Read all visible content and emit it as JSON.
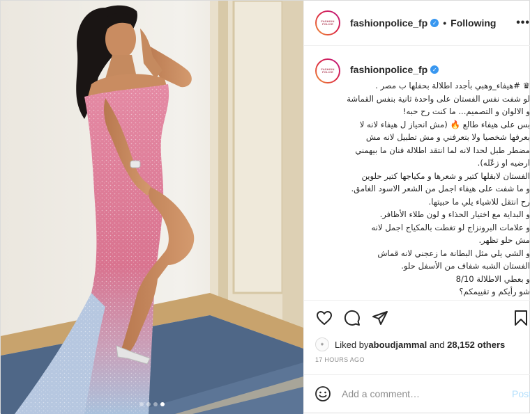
{
  "header": {
    "username": "fashionpolice_fp",
    "separator": "•",
    "follow_label": "Following",
    "more_label": "•••",
    "avatar_text": "FASHION POLICE"
  },
  "caption": {
    "username": "fashionpolice_fp",
    "lines": [
      "♛ #هيفاء_وهبي بأجدد اطلالة بحفلها ب مصر .",
      "لو شفت نفس الفستان على واحدة ثانية بنفس القماشة",
      "و الالوان و التصميم... ما كنت رح حبه!",
      "بس على هيفاء طالع 🔥 (مش انحياز ل هيفاء لانه لا",
      "بعرفها شخصيا ولا بتعرفني و مش تطبيل لانه مش",
      "مضطر طبل لحدا لانه لما انتقد اطلالة فنان ما بيهمني",
      "ارضيه او زعّله).",
      "الفستان لابقلها كتير و شعرها و مكياجها كتير حلوين",
      "و ما شفت على هيفاء اجمل من الشعر الاسود الغامق.",
      "رح انتقل للاشياء يلي ما حبيتها.",
      "و البداية مع اختيار الحذاء و لون طلاء الأظافر.",
      "و علامات البرونزاج لو تغطت بالمكياج اجمل لانه",
      "مش حلو تظهر.",
      "و الشي يلي مثل البطانة ما زعجني لانه قماش",
      "الفستان الشبه شفاف من الأسفل حلو.",
      "و بعطي الاطلالة 8/10",
      "شو رأيكم و تقييمكم؟"
    ],
    "time_small": "17h"
  },
  "likes": {
    "prefix": "Liked by ",
    "user": "aboudjammal",
    "middle": " and ",
    "count": "28,152 others"
  },
  "time_ago": "17 HOURS AGO",
  "comment_box": {
    "placeholder": "Add a comment…",
    "post_label": "Post"
  },
  "carousel": {
    "count": 4,
    "active_index": 3
  },
  "icons": [
    "heart-icon",
    "comment-icon",
    "share-icon",
    "bookmark-icon",
    "emoji-icon",
    "verified-icon",
    "more-icon"
  ],
  "colors": {
    "verified": "#3897f0",
    "post_disabled": "#b2dffc",
    "muted": "#8e8e8e",
    "dress_pink": "#d9738f",
    "dress_blue": "#a9c1dc"
  }
}
